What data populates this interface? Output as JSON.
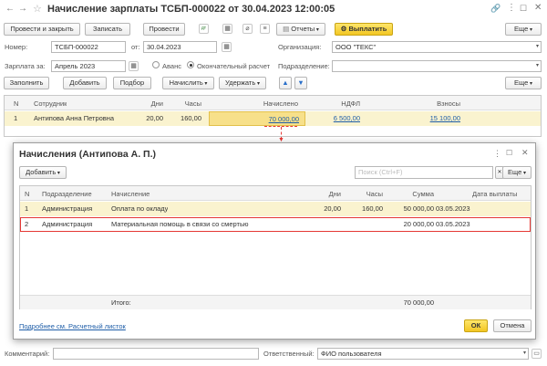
{
  "window": {
    "title": "Начисление зарплаты ТСБП-000022 от 30.04.2023 12:00:05"
  },
  "toolbar": {
    "post_close": "Провести и закрыть",
    "save": "Записать",
    "post": "Провести",
    "reports": "Отчеты",
    "pay": "Выплатить",
    "more": "Еще"
  },
  "header": {
    "number_label": "Номер:",
    "number": "ТСБП-000022",
    "date_label": "от:",
    "date": "30.04.2023",
    "org_label": "Организация:",
    "org": "ООО \"ТЕКС\"",
    "period_label": "Зарплата за:",
    "period": "Апрель 2023",
    "advance": "Аванс",
    "final": "Окончательный расчет",
    "division_label": "Подразделение:",
    "division": ""
  },
  "table_toolbar": {
    "fill": "Заполнить",
    "add": "Добавить",
    "select": "Подбор",
    "accrue": "Начислить",
    "withhold": "Удержать",
    "more": "Еще"
  },
  "table": {
    "columns": [
      "N",
      "Сотрудник",
      "Дни",
      "Часы",
      "Начислено",
      "НДФЛ",
      "Взносы"
    ],
    "rows": [
      {
        "n": "1",
        "employee": "Антипова Анна Петровна",
        "days": "20,00",
        "hours": "160,00",
        "accrued": "70 000,00",
        "ndfl": "6 500,00",
        "contrib": "15 100,00"
      }
    ]
  },
  "dialog": {
    "title": "Начисления (Антипова А. П.)",
    "add": "Добавить",
    "search_placeholder": "Поиск (Ctrl+F)",
    "more": "Еще",
    "columns": [
      "N",
      "Подразделение",
      "Начисление",
      "Дни",
      "Часы",
      "Сумма",
      "Дата выплаты"
    ],
    "rows": [
      {
        "n": "1",
        "division": "Администрация",
        "accrual": "Оплата по окладу",
        "days": "20,00",
        "hours": "160,00",
        "sum": "50 000,00",
        "date": "03.05.2023"
      },
      {
        "n": "2",
        "division": "Администрация",
        "accrual": "Материальная помощь в связи со смертью",
        "days": "",
        "hours": "",
        "sum": "20 000,00",
        "date": "03.05.2023"
      }
    ],
    "total_label": "Итого:",
    "total": "70 000,00",
    "link": "Подробнее см. Расчетный листок",
    "ok": "ОК",
    "cancel": "Отмена"
  },
  "footer": {
    "comment_label": "Комментарий:",
    "comment": "",
    "responsible_label": "Ответственный:",
    "responsible": "ФИО пользователя"
  },
  "colors": {
    "accent_yellow": "#f6d23a",
    "row_highlight": "#faf3cf",
    "selected_cell": "#f7e08a",
    "marker_red": "#e53935",
    "link_blue": "#1f5ea8"
  }
}
